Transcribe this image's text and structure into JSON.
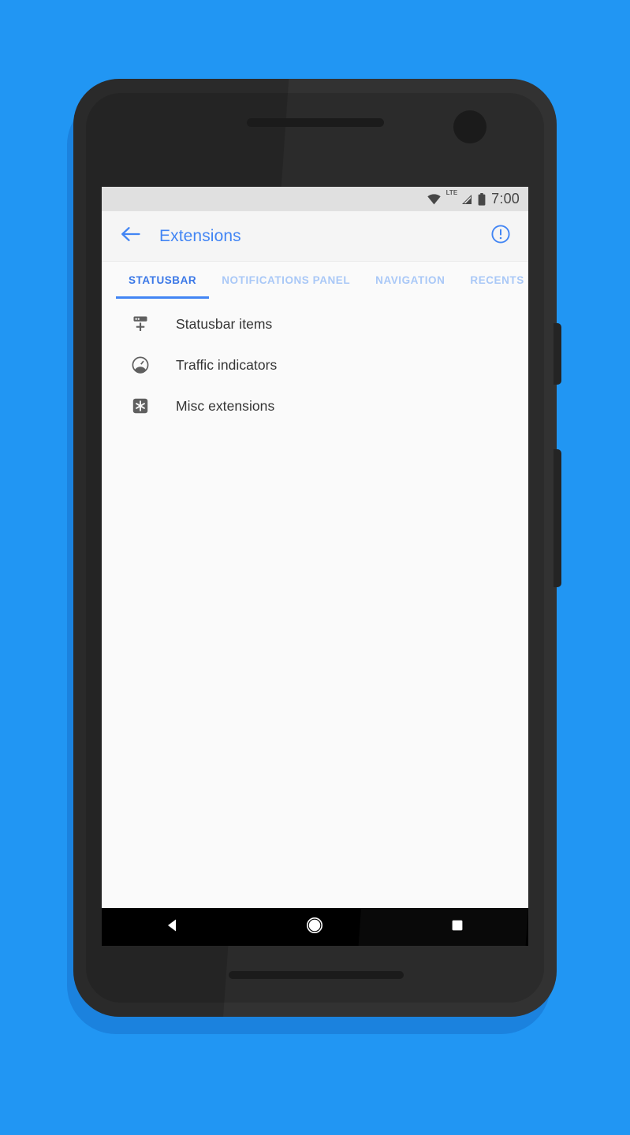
{
  "background_color": "#2196f3",
  "device": {
    "body_color": "#323232",
    "shadow_color": "#1b82de",
    "speaker_grille": "speaker-grille",
    "front_camera": "front-camera",
    "buttons": [
      "power-button",
      "volume-rocker"
    ]
  },
  "status_bar": {
    "background": "#e0e0e0",
    "wifi_icon": "wifi-icon",
    "network_label": "LTE",
    "signal_icon": "signal-icon",
    "battery_icon": "battery-icon",
    "time": "7:00"
  },
  "toolbar": {
    "background": "#f5f5f5",
    "back_icon": "arrow-back-icon",
    "title": "Extensions",
    "accent_color": "#4285f4",
    "action_icon": "info-circle-icon"
  },
  "tabs": {
    "active_index": 0,
    "items": [
      {
        "label": "STATUSBAR",
        "active": true
      },
      {
        "label": "NOTIFICATIONS PANEL",
        "active": false
      },
      {
        "label": "NAVIGATION",
        "active": false
      },
      {
        "label": "RECENTS",
        "active": false
      }
    ],
    "indicator_color": "#4285f4",
    "inactive_color": "#a9c8f7"
  },
  "list": {
    "items": [
      {
        "label": "Statusbar items",
        "icon": "statusbar-add-icon"
      },
      {
        "label": "Traffic indicators",
        "icon": "speedometer-icon"
      },
      {
        "label": "Misc extensions",
        "icon": "asterisk-square-icon"
      }
    ]
  },
  "nav_bar": {
    "background": "#000000",
    "back": "nav-back-icon",
    "home": "nav-home-icon",
    "recents": "nav-recents-icon"
  }
}
